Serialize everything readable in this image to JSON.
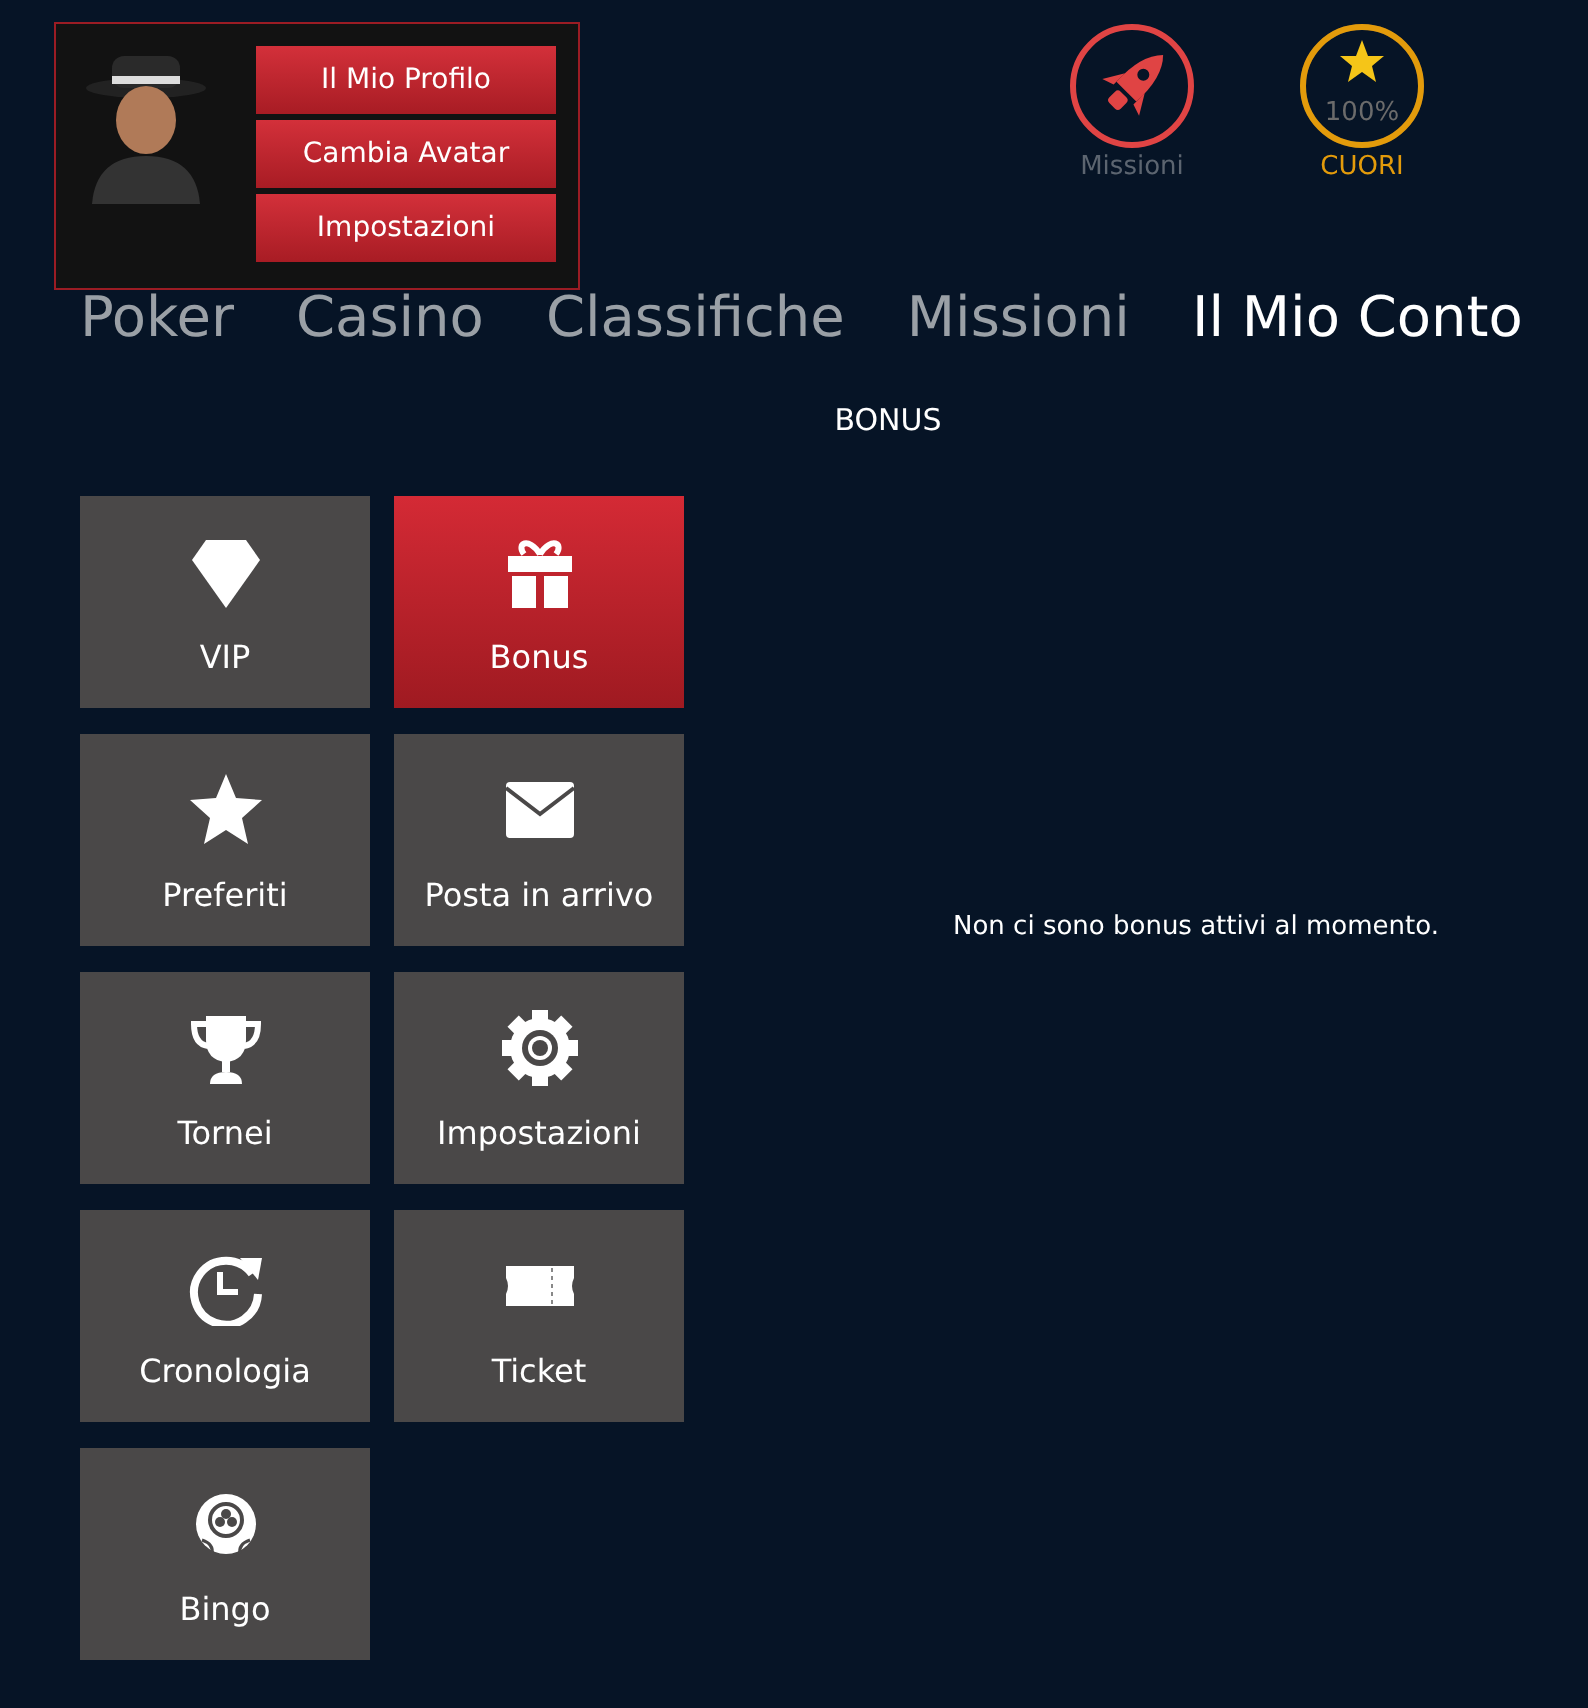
{
  "profile_menu": {
    "buttons": [
      "Il Mio Profilo",
      "Cambia Avatar",
      "Impostazioni"
    ]
  },
  "header_badges": [
    {
      "kind": "missions",
      "label": "Missioni"
    },
    {
      "kind": "hearts",
      "label": "CUORI",
      "reading": "100%",
      "level": 1
    }
  ],
  "nav": [
    {
      "label": "Poker",
      "selected": false
    },
    {
      "label": "Casino",
      "selected": false
    },
    {
      "label": "Classifiche",
      "selected": false
    },
    {
      "label": "Missioni",
      "selected": false
    },
    {
      "label": "Il Mio Conto",
      "selected": true
    }
  ],
  "section_title": "BONUS",
  "tiles": [
    {
      "kind": "vip",
      "label": "VIP",
      "selected": false
    },
    {
      "kind": "bonus",
      "label": "Bonus",
      "selected": true
    },
    {
      "kind": "favorites",
      "label": "Preferiti",
      "selected": false
    },
    {
      "kind": "inbox",
      "label": "Posta in arrivo",
      "selected": false
    },
    {
      "kind": "tournaments",
      "label": "Tornei",
      "selected": false
    },
    {
      "kind": "settings",
      "label": "Impostazioni",
      "selected": false
    },
    {
      "kind": "history",
      "label": "Cronologia",
      "selected": false
    },
    {
      "kind": "ticket",
      "label": "Ticket",
      "selected": false
    },
    {
      "kind": "bingo",
      "label": "Bingo",
      "selected": false
    }
  ],
  "message": "Non ci sono bonus attivi al momento."
}
